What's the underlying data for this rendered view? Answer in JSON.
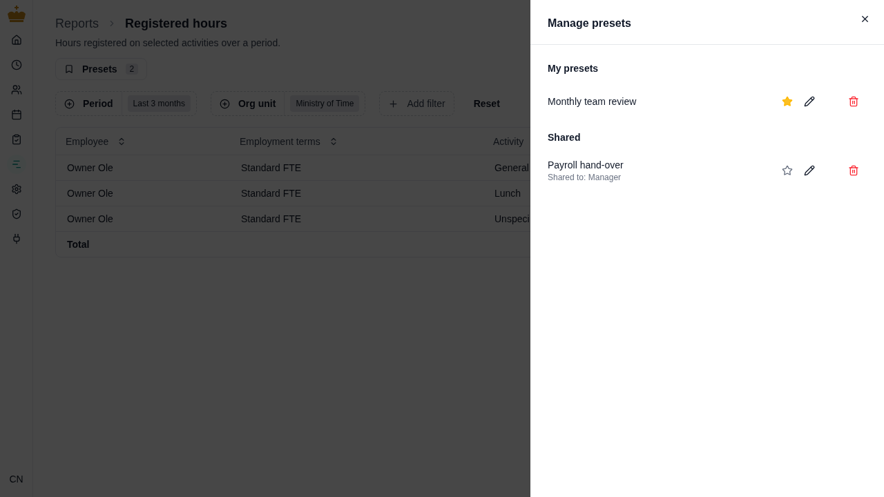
{
  "sidebar": {
    "items": [
      {
        "selected": false
      },
      {
        "selected": false
      },
      {
        "selected": false
      },
      {
        "selected": false
      },
      {
        "selected": false
      },
      {
        "selected": true
      },
      {
        "selected": false
      },
      {
        "selected": false
      },
      {
        "selected": false
      }
    ],
    "user_initials": "CN"
  },
  "breadcrumb": {
    "parent": "Reports",
    "current": "Registered hours"
  },
  "subtitle": "Hours registered on selected activities over a period.",
  "presets_button": {
    "label": "Presets",
    "count": "2"
  },
  "filters": [
    {
      "label": "Period",
      "value": "Last 3 months"
    },
    {
      "label": "Org unit",
      "value": "Ministry of Time"
    }
  ],
  "add_filter": "Add filter",
  "reset": "Reset",
  "table": {
    "columns": [
      {
        "label": "Employee",
        "sortable": true
      },
      {
        "label": "Employment terms",
        "sortable": true
      },
      {
        "label": "Activity",
        "sortable": false
      }
    ],
    "rows": [
      [
        "Owner Ole",
        "Standard FTE",
        "General"
      ],
      [
        "Owner Ole",
        "Standard FTE",
        "Lunch"
      ],
      [
        "Owner Ole",
        "Standard FTE",
        "Unspeci"
      ]
    ],
    "total": "Total"
  },
  "drawer": {
    "title": "Manage presets",
    "sections": [
      {
        "title": "My presets",
        "presets": [
          {
            "name": "Monthly team review",
            "favorite": true
          }
        ]
      },
      {
        "title": "Shared",
        "presets": [
          {
            "name": "Payroll hand-over",
            "note": "Shared to: Manager",
            "favorite": false
          }
        ]
      }
    ]
  }
}
